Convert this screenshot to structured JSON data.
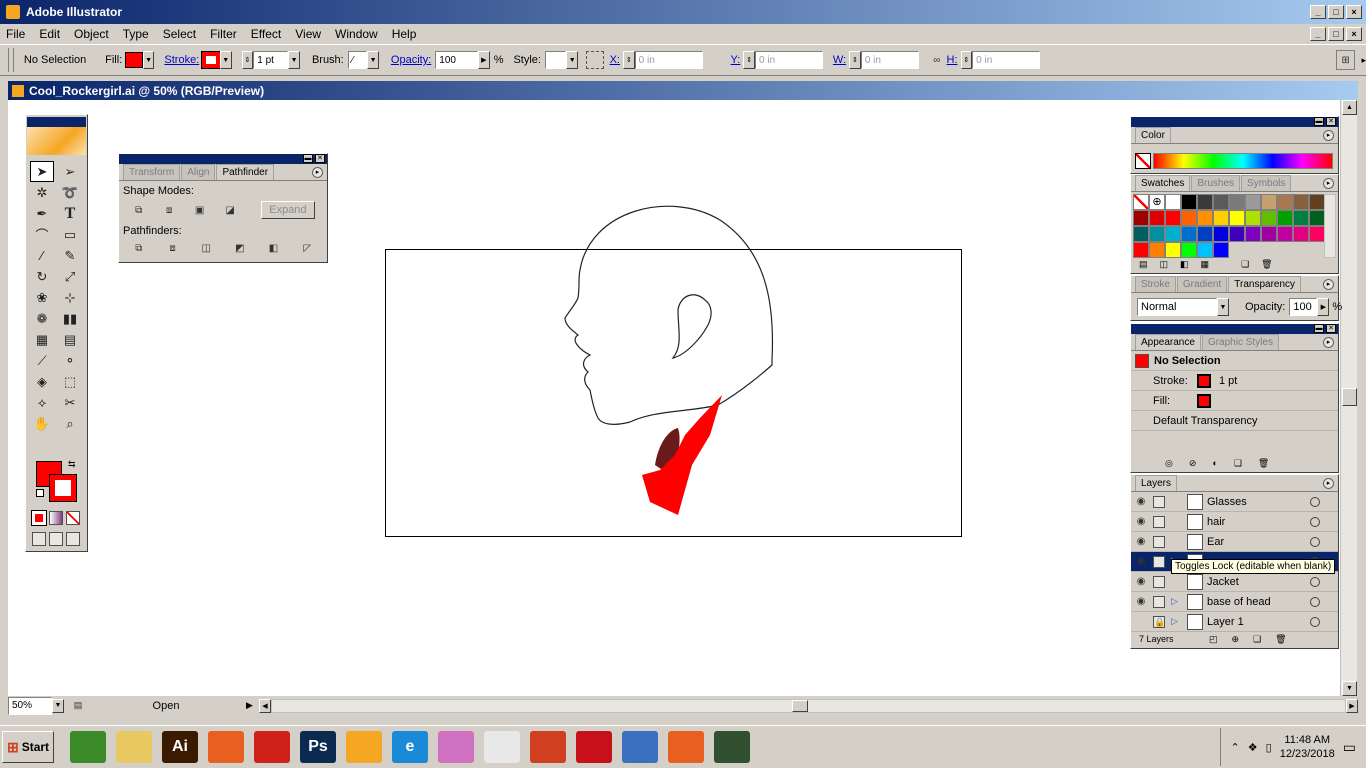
{
  "app": {
    "title": "Adobe Illustrator",
    "window_buttons": [
      "_",
      "□",
      "×"
    ]
  },
  "menu": [
    "File",
    "Edit",
    "Object",
    "Type",
    "Select",
    "Filter",
    "Effect",
    "View",
    "Window",
    "Help"
  ],
  "control": {
    "selection": "No Selection",
    "fill_label": "Fill:",
    "stroke_label": "Stroke:",
    "stroke_weight": "1 pt",
    "brush_label": "Brush:",
    "opacity_label": "Opacity:",
    "opacity_value": "100",
    "percent": "%",
    "style_label": "Style:",
    "x_label": "X:",
    "x_value": "0 in",
    "y_label": "Y:",
    "y_value": "0 in",
    "w_label": "W:",
    "w_value": "0 in",
    "h_label": "H:",
    "h_value": "0 in",
    "fill_color": "#ff0000"
  },
  "document": {
    "title": "Cool_Rockergirl.ai @ 50% (RGB/Preview)"
  },
  "status": {
    "zoom": "50%",
    "mode": "Open"
  },
  "pathfinder": {
    "tabs": [
      "Transform",
      "Align",
      "Pathfinder"
    ],
    "shape_modes": "Shape Modes:",
    "expand": "Expand",
    "pathfinders": "Pathfinders:"
  },
  "color_panel": {
    "tab": "Color"
  },
  "swatches_panel": {
    "tabs": [
      "Swatches",
      "Brushes",
      "Symbols"
    ],
    "rows": [
      [
        "none",
        "reg",
        "#ffffff",
        "#000000",
        "#3a3a3a",
        "#5a5a5a",
        "#7a7a7a",
        "#9a9a9a",
        "#c8a070",
        "#a87850",
        "#886040",
        "#604020"
      ],
      [
        "#a00000",
        "#e00000",
        "#ff0000",
        "#ff6000",
        "#ff9000",
        "#ffd000",
        "#ffff00",
        "#b0e000",
        "#60c000",
        "#00a000",
        "#008040",
        "#006020"
      ],
      [
        "#006060",
        "#0090a0",
        "#00b0d0",
        "#0070d0",
        "#0040c0",
        "#0000e0",
        "#4000c0",
        "#8000c0",
        "#a000a0",
        "#c000a0",
        "#e00080",
        "#ff0060"
      ],
      [
        "#ff0000",
        "#ff8000",
        "#ffff00",
        "#00ff00",
        "#00c0ff",
        "#0000ff"
      ]
    ]
  },
  "stroke_panel": {
    "tabs": [
      "Stroke",
      "Gradient",
      "Transparency"
    ],
    "blend_mode": "Normal",
    "opacity_label": "Opacity:",
    "opacity_value": "100",
    "percent": "%"
  },
  "appearance_panel": {
    "tabs": [
      "Appearance",
      "Graphic Styles"
    ],
    "title": "No Selection",
    "stroke_label": "Stroke:",
    "stroke_weight": "1 pt",
    "fill_label": "Fill:",
    "transparency": "Default Transparency"
  },
  "layers_panel": {
    "tab": "Layers",
    "layers": [
      {
        "name": "Glasses",
        "visible": true,
        "locked": false,
        "expandable": false
      },
      {
        "name": "hair",
        "visible": true,
        "locked": false,
        "expandable": false
      },
      {
        "name": "Ear",
        "visible": true,
        "locked": false,
        "expandable": false
      },
      {
        "name": "",
        "visible": true,
        "locked": false,
        "expandable": true,
        "selected": true
      },
      {
        "name": "Jacket",
        "visible": true,
        "locked": false,
        "expandable": false
      },
      {
        "name": "base of head",
        "visible": true,
        "locked": false,
        "expandable": true
      },
      {
        "name": "Layer 1",
        "visible": false,
        "locked": true,
        "expandable": true
      }
    ],
    "tooltip": "Toggles Lock (editable when blank)",
    "count": "7 Layers"
  },
  "taskbar": {
    "start": "Start",
    "time": "11:48 AM",
    "date": "12/23/2018",
    "apps": [
      {
        "name": "gecko",
        "label": "",
        "color": "#3a8a2a"
      },
      {
        "name": "explorer",
        "label": "",
        "color": "#e8c860"
      },
      {
        "name": "illustrator",
        "label": "Ai",
        "color": "#3a1a00"
      },
      {
        "name": "firefox",
        "label": "",
        "color": "#e86020"
      },
      {
        "name": "creative-cloud",
        "label": "",
        "color": "#d0201a"
      },
      {
        "name": "photoshop",
        "label": "Ps",
        "color": "#0a2a50"
      },
      {
        "name": "illustrator-flower",
        "label": "",
        "color": "#f5a623"
      },
      {
        "name": "internet-explorer",
        "label": "e",
        "color": "#1a8ad8"
      },
      {
        "name": "butterfly",
        "label": "",
        "color": "#d070c0"
      },
      {
        "name": "viewer",
        "label": "",
        "color": "#e8e8e8"
      },
      {
        "name": "office",
        "label": "",
        "color": "#d04020"
      },
      {
        "name": "acrobat",
        "label": "",
        "color": "#c8101a"
      },
      {
        "name": "feather",
        "label": "",
        "color": "#3a70c0"
      },
      {
        "name": "firefox-2",
        "label": "",
        "color": "#e86020"
      },
      {
        "name": "monitor",
        "label": "",
        "color": "#305030"
      }
    ]
  }
}
